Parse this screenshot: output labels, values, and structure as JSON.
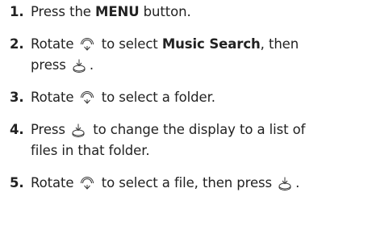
{
  "steps": [
    {
      "number": "1.",
      "before": "Press the ",
      "bold": "MENU",
      "after": " button."
    },
    {
      "number": "2.",
      "line1_a": "Rotate ",
      "icon1": "dial-rotate-icon",
      "line1_b": " to select ",
      "bold": "Music Search",
      "line1_c": ", then",
      "line2_a": "press ",
      "icon2": "dial-press-icon",
      "line2_b": "."
    },
    {
      "number": "3.",
      "a": "Rotate ",
      "icon": "dial-rotate-icon",
      "b": " to select a folder."
    },
    {
      "number": "4.",
      "line1_a": "Press ",
      "icon": "dial-press-icon",
      "line1_b": " to change the display to a list of",
      "line2": "files in that folder."
    },
    {
      "number": "5.",
      "a": "Rotate ",
      "icon1": "dial-rotate-icon",
      "b": " to select a file, then press ",
      "icon2": "dial-press-icon",
      "c": "."
    }
  ]
}
